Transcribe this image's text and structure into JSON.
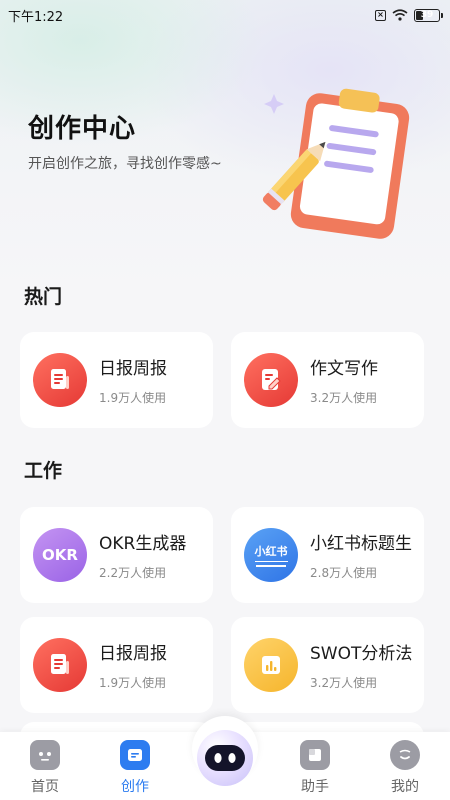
{
  "status_bar": {
    "time": "下午1:22",
    "sim_icon": "sim-off-icon",
    "wifi_icon": "wifi-icon",
    "battery_level": "39",
    "battery_fraction": 0.39
  },
  "hero": {
    "title": "创作中心",
    "subtitle": "开启创作之旅，寻找创作零感~",
    "illustration": "clipboard-pencil-illustration"
  },
  "sections": [
    {
      "title": "热门",
      "cards": [
        {
          "name": "日报周报",
          "usage": "1.9万人使用",
          "icon": "document-icon",
          "color": "#e84a3c"
        },
        {
          "name": "作文写作",
          "usage": "3.2万人使用",
          "icon": "edit-document-icon",
          "color": "#e84a3c"
        }
      ]
    },
    {
      "title": "工作",
      "cards": [
        {
          "name": "OKR生成器",
          "usage": "2.2万人使用",
          "icon": "okr-icon",
          "icon_text": "OKR",
          "color": "#a672ea"
        },
        {
          "name": "小红书标题生",
          "usage": "2.8万人使用",
          "icon": "xiaohongshu-icon",
          "icon_text": "小红书",
          "color": "#3b82ee"
        },
        {
          "name": "日报周报",
          "usage": "1.9万人使用",
          "icon": "document-icon",
          "color": "#e84a3c"
        },
        {
          "name": "SWOT分析法",
          "usage": "3.2万人使用",
          "icon": "chart-icon",
          "color": "#f6bb3a"
        }
      ]
    }
  ],
  "tab_bar": {
    "active": "创作",
    "accent": "#2d7cf0",
    "tabs": [
      {
        "label": "首页",
        "icon": "home-icon"
      },
      {
        "label": "创作",
        "icon": "create-icon"
      },
      {
        "label": "",
        "icon": "robot-assistant-icon"
      },
      {
        "label": "助手",
        "icon": "assistant-icon"
      },
      {
        "label": "我的",
        "icon": "profile-icon"
      }
    ]
  }
}
